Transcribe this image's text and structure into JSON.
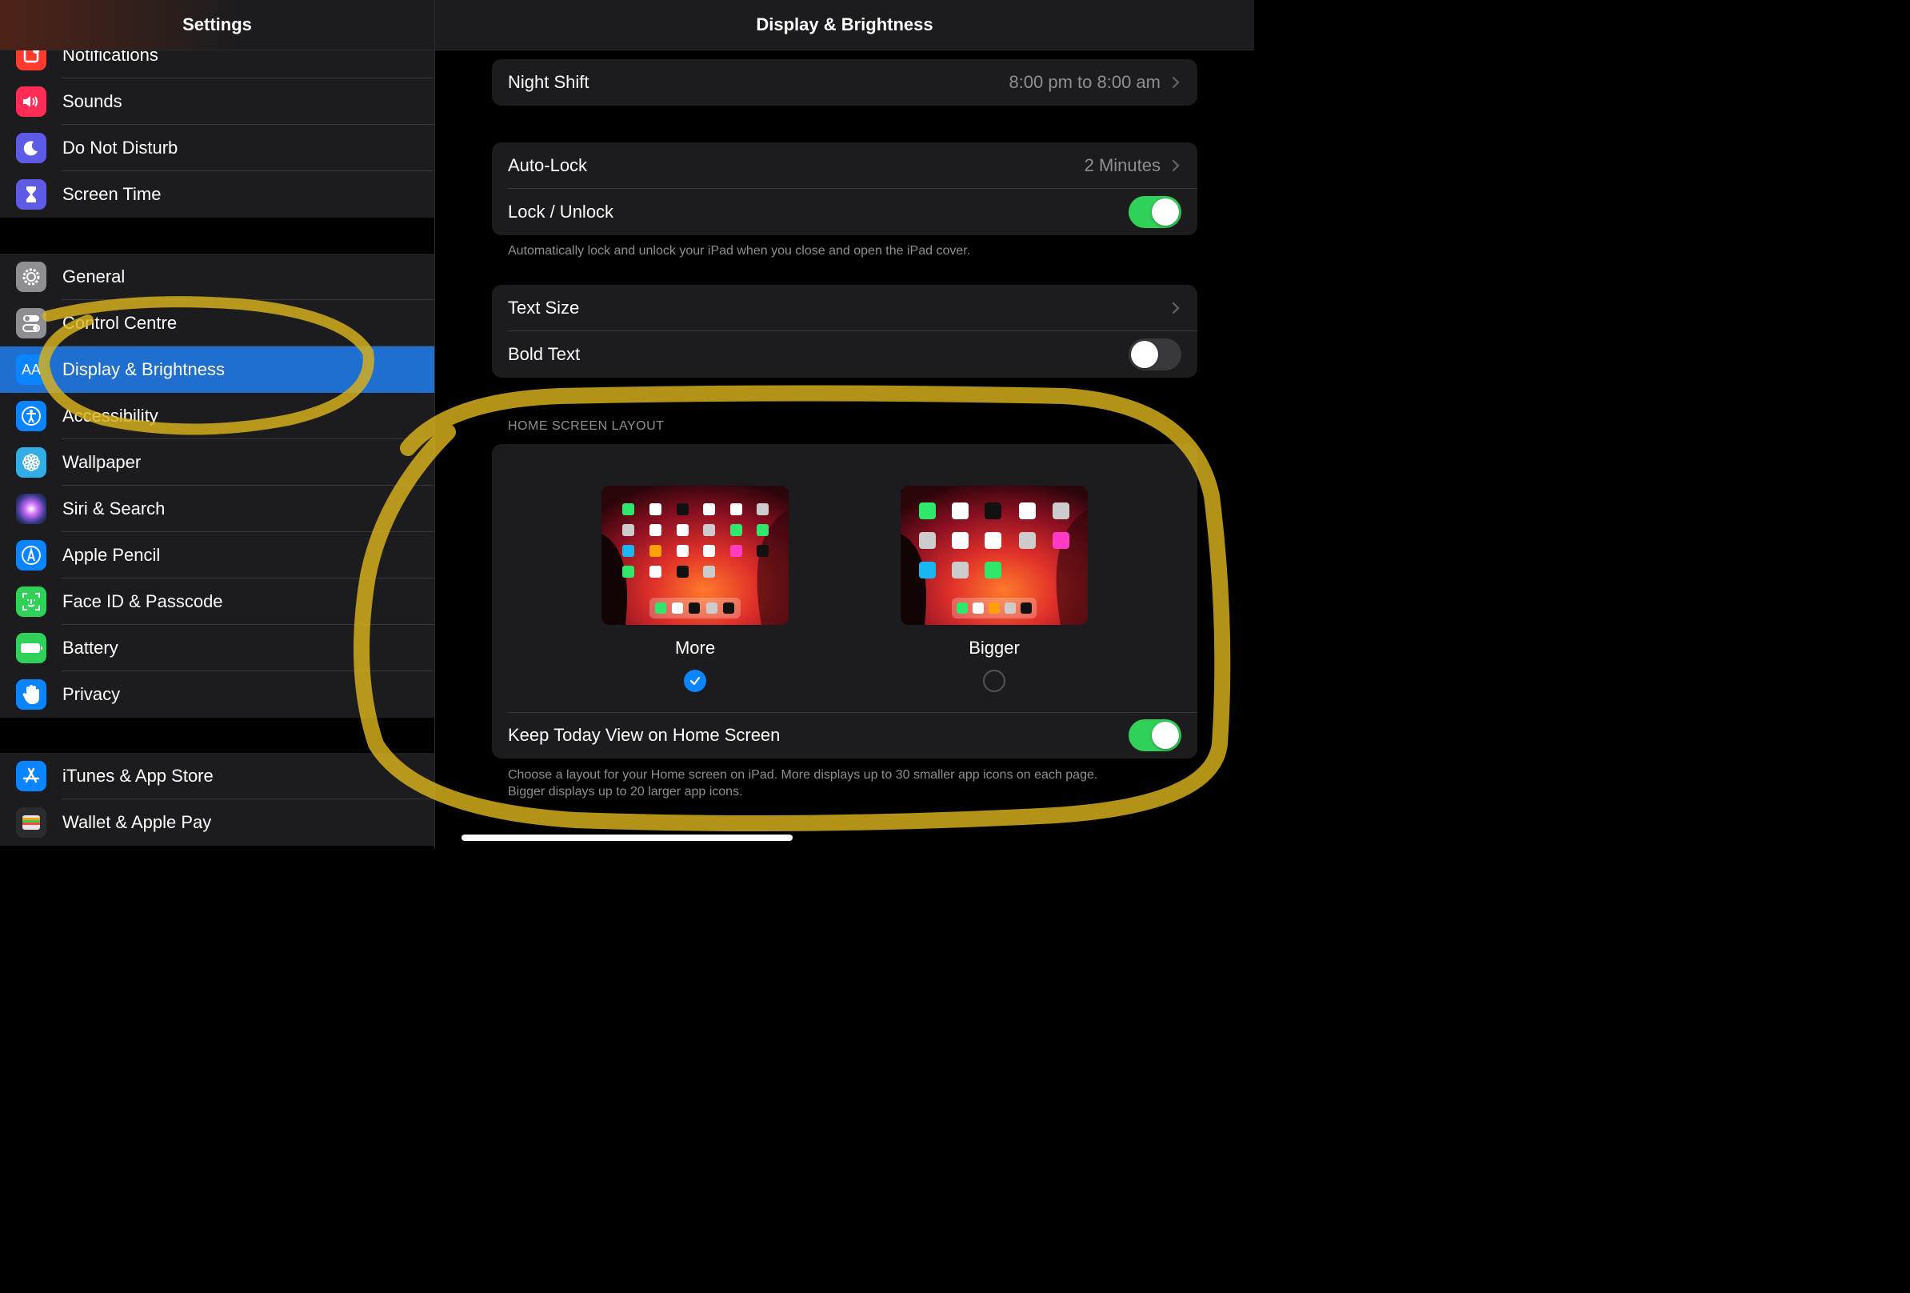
{
  "sidebar": {
    "title": "Settings",
    "groups": [
      {
        "items": [
          {
            "label": "Notifications",
            "icon": "notifications-icon",
            "color": "#ff3b30"
          },
          {
            "label": "Sounds",
            "icon": "speaker-icon",
            "color": "#ff2d55"
          },
          {
            "label": "Do Not Disturb",
            "icon": "moon-icon",
            "color": "#5e5ce6"
          },
          {
            "label": "Screen Time",
            "icon": "hourglass-icon",
            "color": "#5e5ce6"
          }
        ]
      },
      {
        "items": [
          {
            "label": "General",
            "icon": "gear-icon",
            "color": "#8e8e93"
          },
          {
            "label": "Control Centre",
            "icon": "toggles-icon",
            "color": "#8e8e93"
          },
          {
            "label": "Display & Brightness",
            "icon": "text-size-icon",
            "color": "#0a84ff",
            "icon_text": "AA",
            "selected": true
          },
          {
            "label": "Accessibility",
            "icon": "accessibility-icon",
            "color": "#0a84ff"
          },
          {
            "label": "Wallpaper",
            "icon": "flower-icon",
            "color": "#32ade6"
          },
          {
            "label": "Siri & Search",
            "icon": "siri-icon",
            "color": "#1c1c3a"
          },
          {
            "label": "Apple Pencil",
            "icon": "pencil-icon",
            "color": "#0a84ff"
          },
          {
            "label": "Face ID & Passcode",
            "icon": "face-id-icon",
            "color": "#30d158"
          },
          {
            "label": "Battery",
            "icon": "battery-icon",
            "color": "#30d158"
          },
          {
            "label": "Privacy",
            "icon": "hand-icon",
            "color": "#0a84ff"
          }
        ]
      },
      {
        "items": [
          {
            "label": "iTunes & App Store",
            "icon": "app-store-icon",
            "color": "#0a84ff"
          },
          {
            "label": "Wallet & Apple Pay",
            "icon": "wallet-icon",
            "color": "#2c2c2e"
          }
        ]
      }
    ]
  },
  "main": {
    "title": "Display & Brightness",
    "night_shift": {
      "label": "Night Shift",
      "value": "8:00 pm to 8:00 am"
    },
    "auto_lock": {
      "label": "Auto-Lock",
      "value": "2 Minutes"
    },
    "lock_unlock": {
      "label": "Lock / Unlock",
      "on": true
    },
    "lock_footnote": "Automatically lock and unlock your iPad when you close and open the iPad cover.",
    "text_size": {
      "label": "Text Size"
    },
    "bold_text": {
      "label": "Bold Text",
      "on": false
    },
    "home_layout": {
      "section_title": "HOME SCREEN LAYOUT",
      "options": [
        {
          "label": "More",
          "selected": true
        },
        {
          "label": "Bigger",
          "selected": false
        }
      ],
      "keep_today": {
        "label": "Keep Today View on Home Screen",
        "on": true
      },
      "footnote_line1": "Choose a layout for your Home screen on iPad. More displays up to 30 smaller app icons on each page.",
      "footnote_line2": "Bigger displays up to 20 larger app icons."
    }
  },
  "colors": {
    "accent": "#0a84ff",
    "selected_row": "#1f6fd0",
    "toggle_on": "#30d158",
    "annotation_highlight": "#d9b21c"
  }
}
